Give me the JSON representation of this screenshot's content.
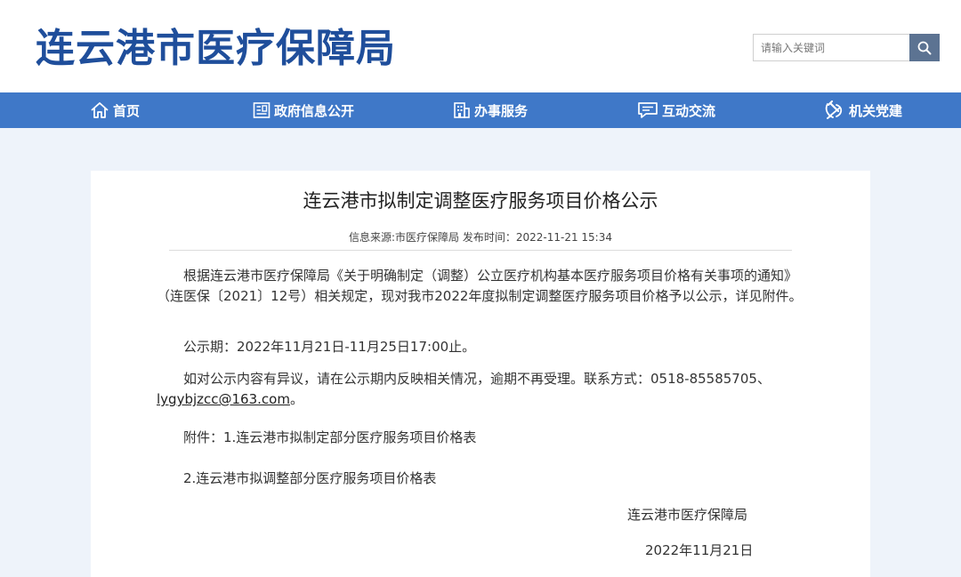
{
  "header": {
    "site_title": "连云港市医疗保障局",
    "search_placeholder": "请输入关键词"
  },
  "nav": {
    "items": [
      {
        "label": "首页",
        "icon": "home-icon"
      },
      {
        "label": "政府信息公开",
        "icon": "document-icon"
      },
      {
        "label": "办事服务",
        "icon": "building-icon"
      },
      {
        "label": "互动交流",
        "icon": "chat-icon"
      },
      {
        "label": "机关党建",
        "icon": "party-emblem-icon"
      }
    ]
  },
  "article": {
    "title": "连云港市拟制定调整医疗服务项目价格公示",
    "meta": "信息来源:市医疗保障局 发布时间：2022-11-21 15:34",
    "paragraph1": "根据连云港市医疗保障局《关于明确制定（调整）公立医疗机构基本医疗服务项目价格有关事项的通知》（连医保〔2021〕12号）相关规定，现对我市2022年度拟制定调整医疗服务项目价格予以公示，详见附件。",
    "paragraph2": "公示期：2022年11月21日-11月25日17:00止。",
    "paragraph3_prefix": "如对公示内容有异议，请在公示期内反映相关情况，逾期不再受理。联系方式：0518-85585705、",
    "email": "lygybjzcc@163.com",
    "paragraph3_suffix": "。",
    "attachment1": "附件：1.连云港市拟制定部分医疗服务项目价格表",
    "attachment2": "2.连云港市拟调整部分医疗服务项目价格表",
    "signature": "连云港市医疗保障局",
    "date": "2022年11月21日"
  },
  "colors": {
    "title_blue": "#1f4e9b",
    "nav_blue": "#3f78c8",
    "search_button": "#5c7392",
    "page_background": "#eef3fa"
  }
}
